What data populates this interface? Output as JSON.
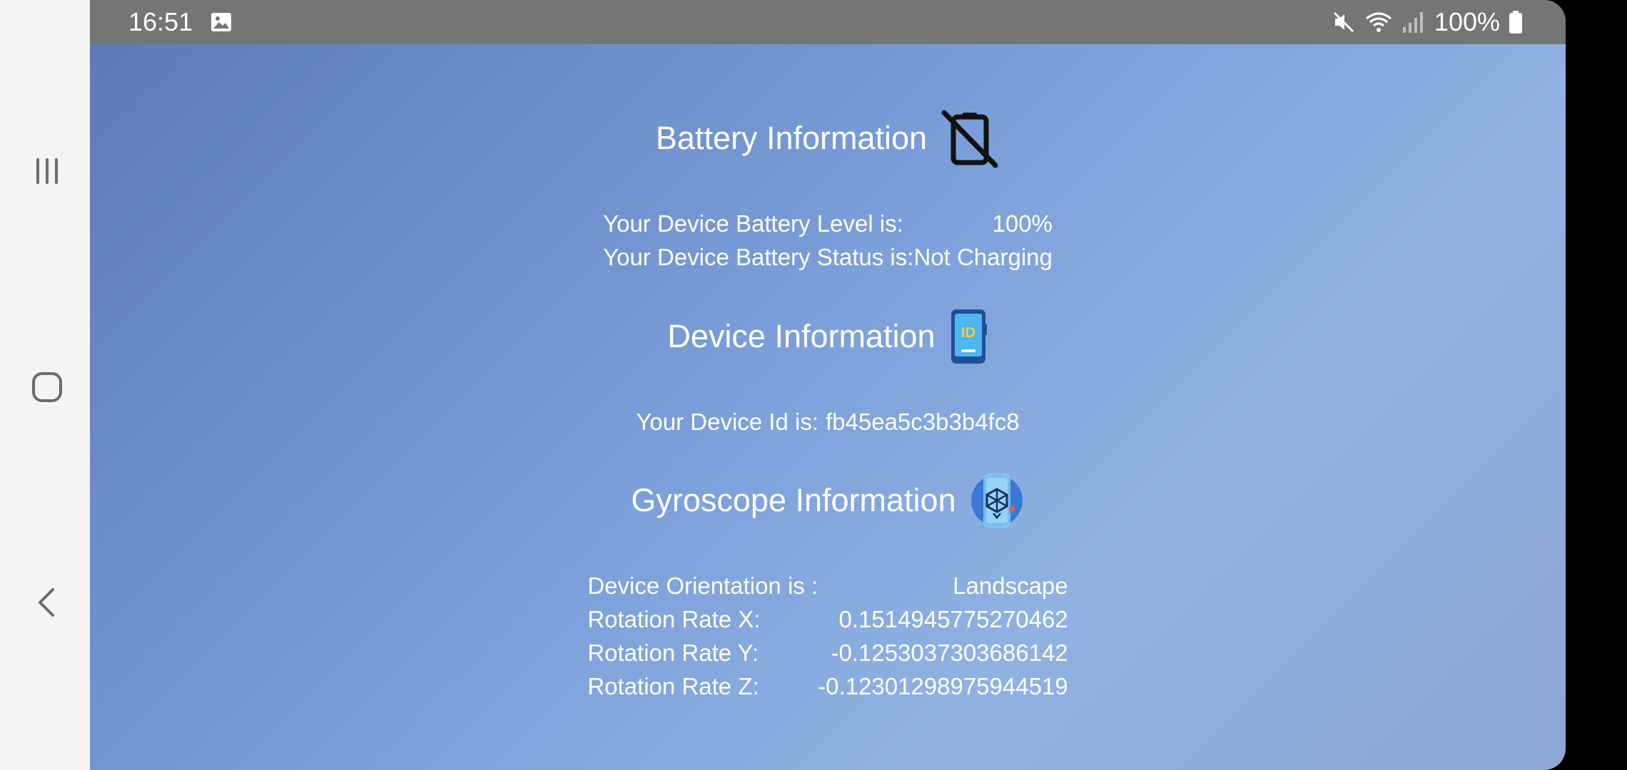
{
  "status_bar": {
    "time": "16:51",
    "battery_percent": "100%",
    "icons": [
      "gallery-icon",
      "mute-icon",
      "wifi-icon",
      "signal-icon",
      "battery-icon"
    ]
  },
  "navigation": {
    "recents_icon": "recents-icon",
    "home_icon": "home-icon",
    "back_icon": "back-icon"
  },
  "battery": {
    "title": "Battery Information",
    "icon": "battery-off-icon",
    "level_label": "Your Device Battery Level is:",
    "level_value": "100%",
    "status_label": "Your Device Battery Status is:",
    "status_value": "Not Charging"
  },
  "device": {
    "title": "Device Information",
    "icon": "phone-id-icon",
    "id_label": "Your Device Id is:",
    "id_value": "fb45ea5c3b3b4fc8",
    "icon_text": "ID"
  },
  "gyroscope": {
    "title": "Gyroscope Information",
    "icon": "gyroscope-icon",
    "orientation_label": "Device Orientation is :",
    "orientation_value": "Landscape",
    "rotation_x_label": "Rotation Rate X:",
    "rotation_x_value": "0.1514945775270462",
    "rotation_y_label": "Rotation Rate Y:",
    "rotation_y_value": "-0.1253037303686142",
    "rotation_z_label": "Rotation Rate Z:",
    "rotation_z_value": "-0.12301298975944519"
  },
  "colors": {
    "status_bar": "#757575",
    "nav_bar": "#f4f4f4",
    "gradient_start": "#5a7ab7",
    "gradient_end": "#8fb2e2",
    "text": "#ffffff"
  }
}
